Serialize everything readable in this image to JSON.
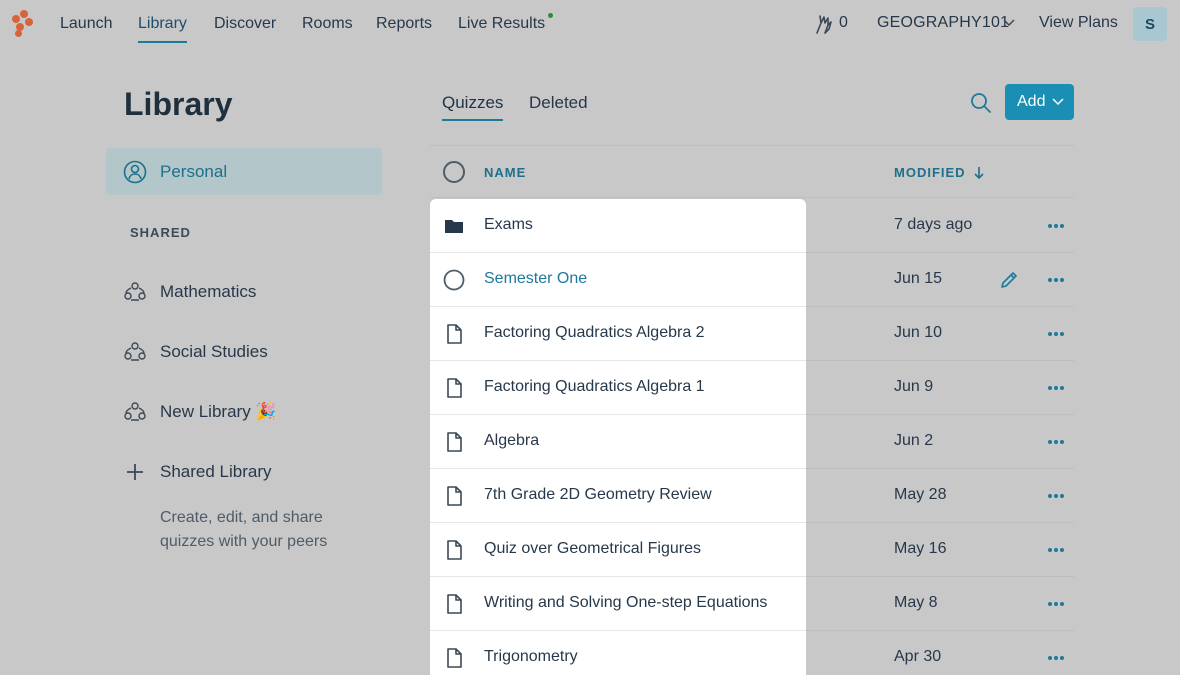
{
  "nav": {
    "items": [
      "Launch",
      "Library",
      "Discover",
      "Rooms",
      "Reports",
      "Live Results"
    ],
    "active": "Library",
    "hand_count": "0",
    "class_name": "GEOGRAPHY101",
    "view_plans": "View Plans",
    "avatar_initial": "S",
    "brand_color": "#d8633a",
    "live_dot_color": "#2e8b3e"
  },
  "sidebar": {
    "title": "Library",
    "personal_label": "Personal",
    "shared_heading": "SHARED",
    "shared_items": [
      {
        "label": "Mathematics",
        "icon": "shared-group-icon"
      },
      {
        "label": "Social Studies",
        "icon": "shared-group-icon"
      },
      {
        "label": "New Library 🎉",
        "icon": "shared-group-icon"
      }
    ],
    "create_label": "Shared Library",
    "create_desc": "Create, edit, and share quizzes with your peers"
  },
  "main": {
    "tabs": [
      "Quizzes",
      "Deleted"
    ],
    "active_tab": "Quizzes",
    "add_label": "Add",
    "accent_color": "#1a8eb3",
    "columns": {
      "name": "NAME",
      "modified": "MODIFIED"
    },
    "rows": [
      {
        "type": "folder",
        "name": "Exams",
        "modified": "7 days ago"
      },
      {
        "type": "radio",
        "name": "Semester One",
        "modified": "Jun 15",
        "hover": true
      },
      {
        "type": "doc",
        "name": "Factoring Quadratics Algebra 2",
        "modified": "Jun 10"
      },
      {
        "type": "doc",
        "name": "Factoring Quadratics Algebra 1",
        "modified": "Jun 9"
      },
      {
        "type": "doc",
        "name": "Algebra",
        "modified": "Jun 2"
      },
      {
        "type": "doc",
        "name": "7th Grade 2D Geometry Review",
        "modified": "May 28"
      },
      {
        "type": "doc",
        "name": "Quiz over Geometrical Figures",
        "modified": "May 16"
      },
      {
        "type": "doc",
        "name": "Writing and Solving One-step Equations",
        "modified": "May 8"
      },
      {
        "type": "doc",
        "name": "Trigonometry",
        "modified": "Apr 30"
      }
    ]
  }
}
